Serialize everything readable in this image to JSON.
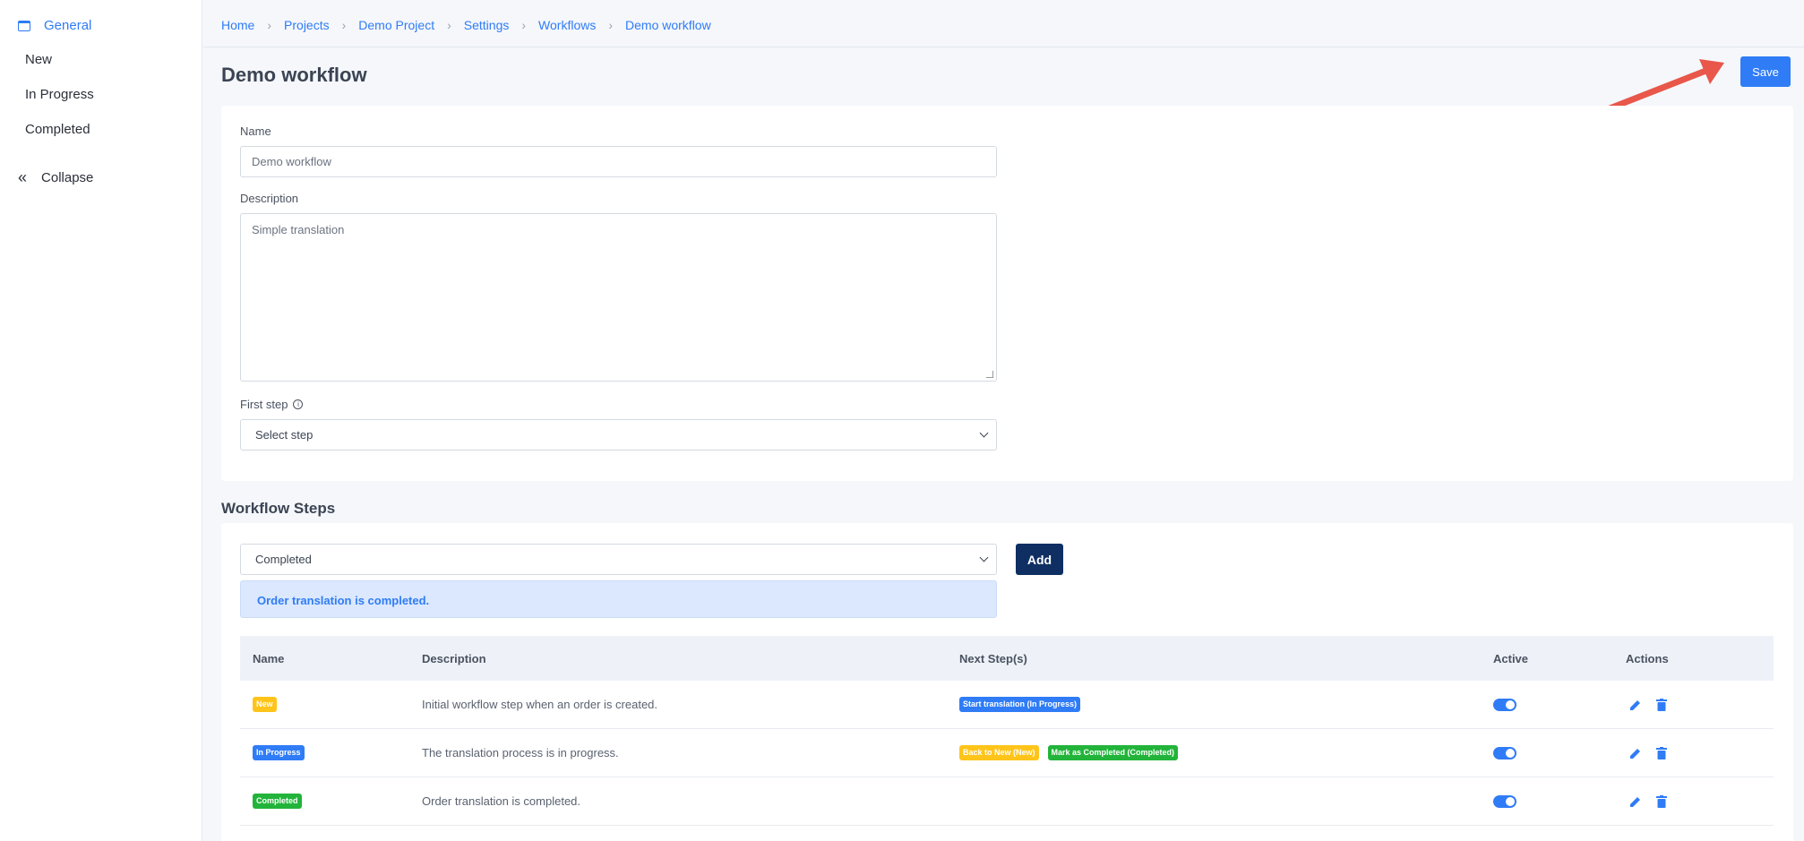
{
  "sidebar": {
    "items": [
      {
        "label": "General",
        "icon": "window-icon"
      },
      {
        "label": "New"
      },
      {
        "label": "In Progress"
      },
      {
        "label": "Completed"
      }
    ],
    "collapse_label": "Collapse"
  },
  "breadcrumb": [
    "Home",
    "Projects",
    "Demo Project",
    "Settings",
    "Workflows",
    "Demo workflow"
  ],
  "page": {
    "title": "Demo workflow",
    "save_label": "Save"
  },
  "form": {
    "name_label": "Name",
    "name_value": "Demo workflow",
    "description_label": "Description",
    "description_value": "Simple translation",
    "first_step_label": "First step",
    "first_step_value": "Select step"
  },
  "steps": {
    "title": "Workflow Steps",
    "select_value": "Completed",
    "add_label": "Add",
    "alert_text": "Order translation is completed.",
    "columns": [
      "Name",
      "Description",
      "Next Step(s)",
      "Active",
      "Actions"
    ],
    "rows": [
      {
        "name": "New",
        "name_color": "#ffc41a",
        "description": "Initial workflow step when an order is created.",
        "next": [
          {
            "label": "Start translation (In Progress)",
            "color": "#2f7cf6"
          }
        ],
        "active": true
      },
      {
        "name": "In Progress",
        "name_color": "#2f7cf6",
        "description": "The translation process is in progress.",
        "next": [
          {
            "label": "Back to New (New)",
            "color": "#ffc41a"
          },
          {
            "label": "Mark as Completed (Completed)",
            "color": "#22b43a"
          }
        ],
        "active": true
      },
      {
        "name": "Completed",
        "name_color": "#22b43a",
        "description": "Order translation is completed.",
        "next": [],
        "active": true
      }
    ]
  },
  "colors": {
    "accent": "#2f7cf6",
    "add_button": "#0f2f63",
    "arrow": "#e8574a"
  }
}
